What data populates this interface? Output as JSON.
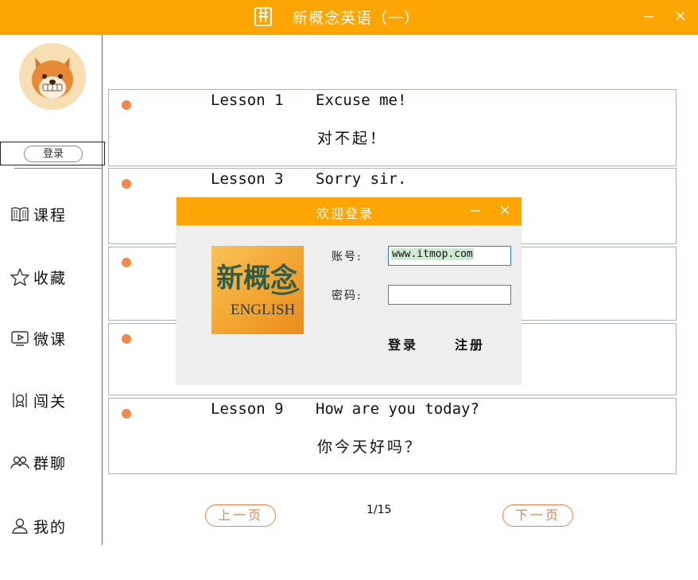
{
  "window": {
    "title": "新概念英语（一）",
    "icons": {
      "app": "book-icon",
      "minimize": "minimize-icon",
      "close": "close-icon"
    },
    "accent": "#fda503"
  },
  "sidebar": {
    "login_label": "登录",
    "items": [
      {
        "label": "课程",
        "icon": "book-open-icon"
      },
      {
        "label": "收藏",
        "icon": "star-icon"
      },
      {
        "label": "微课",
        "icon": "play-screen-icon"
      },
      {
        "label": "闯关",
        "icon": "badge-icon"
      },
      {
        "label": "群聊",
        "icon": "group-icon"
      },
      {
        "label": "我的",
        "icon": "user-icon"
      }
    ]
  },
  "lessons": [
    {
      "number": "Lesson 1",
      "english": "Excuse me!",
      "chinese": "对不起！"
    },
    {
      "number": "Lesson 3",
      "english": "Sorry sir.",
      "chinese": ""
    },
    {
      "number": "",
      "english": "",
      "chinese": ""
    },
    {
      "number": "",
      "english": "",
      "chinese": ""
    },
    {
      "number": "Lesson 9",
      "english": "How are you today?",
      "chinese": "你今天好吗？"
    }
  ],
  "pagination": {
    "prev_label": "上一页",
    "next_label": "下一页",
    "indicator": "1/15"
  },
  "login_dialog": {
    "title": "欢迎登录",
    "logo_text_cn": "新概念",
    "logo_text_en": "ENGLISH",
    "account_label": "账号:",
    "account_value": "www.itmop.com",
    "password_label": "密码:",
    "password_value": "",
    "login_button": "登录",
    "register_button": "注册"
  }
}
